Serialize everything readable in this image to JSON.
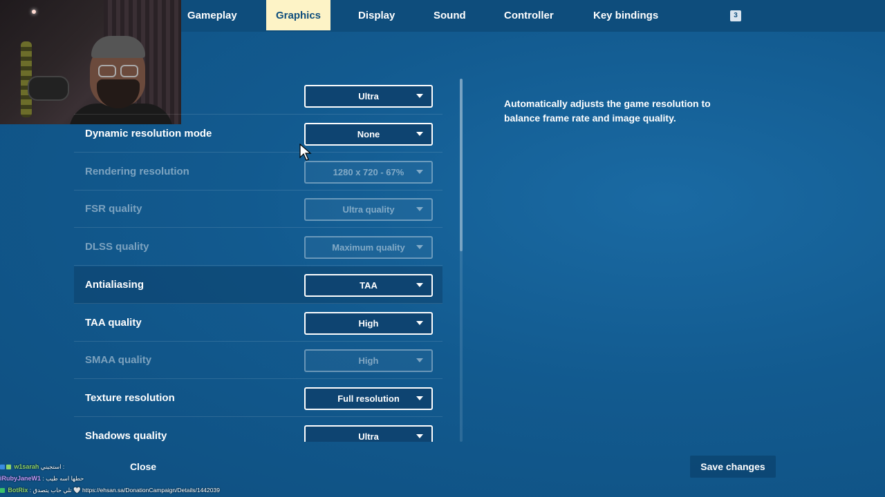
{
  "nav": {
    "tabs": [
      {
        "label": "Gameplay",
        "active": false
      },
      {
        "label": "Graphics",
        "active": true
      },
      {
        "label": "Display",
        "active": false
      },
      {
        "label": "Sound",
        "active": false
      },
      {
        "label": "Controller",
        "active": false
      },
      {
        "label": "Key bindings",
        "active": false
      }
    ],
    "badge": "3"
  },
  "settings": [
    {
      "label": "",
      "value": "Ultra",
      "enabled": true
    },
    {
      "label": "Dynamic resolution mode",
      "value": "None",
      "enabled": true
    },
    {
      "label": "Rendering resolution",
      "value": "1280 x 720 - 67%",
      "enabled": false
    },
    {
      "label": "FSR quality",
      "value": "Ultra quality",
      "enabled": false
    },
    {
      "label": "DLSS quality",
      "value": "Maximum quality",
      "enabled": false
    },
    {
      "label": "Antialiasing",
      "value": "TAA",
      "enabled": true
    },
    {
      "label": "TAA quality",
      "value": "High",
      "enabled": true
    },
    {
      "label": "SMAA quality",
      "value": "High",
      "enabled": false
    },
    {
      "label": "Texture resolution",
      "value": "Full resolution",
      "enabled": true
    },
    {
      "label": "Shadows quality",
      "value": "Ultra",
      "enabled": true
    }
  ],
  "description": "Automatically adjusts the game resolution to balance frame rate and image quality.",
  "footer": {
    "close_label": "Close",
    "save_label": "Save changes"
  },
  "chat": [
    {
      "user": "w1sarah",
      "message": "استجيني :",
      "user_color": "#8fd46a"
    },
    {
      "user": "iRubyJaneW1",
      "message": ": حطها اسه طيب",
      "user_color": "#c89cff"
    },
    {
      "user": "BotRix",
      "message": ": تلي حاب يتصدق 🤍 https://ehsan.sa/DonationCampaign/Details/1442039",
      "user_color": "#8fd46a"
    }
  ],
  "colors": {
    "background": "#125a8f",
    "topbar": "#0e4d7c",
    "active_tab": "#fdf3c6",
    "dropdown": "#0e4471"
  }
}
